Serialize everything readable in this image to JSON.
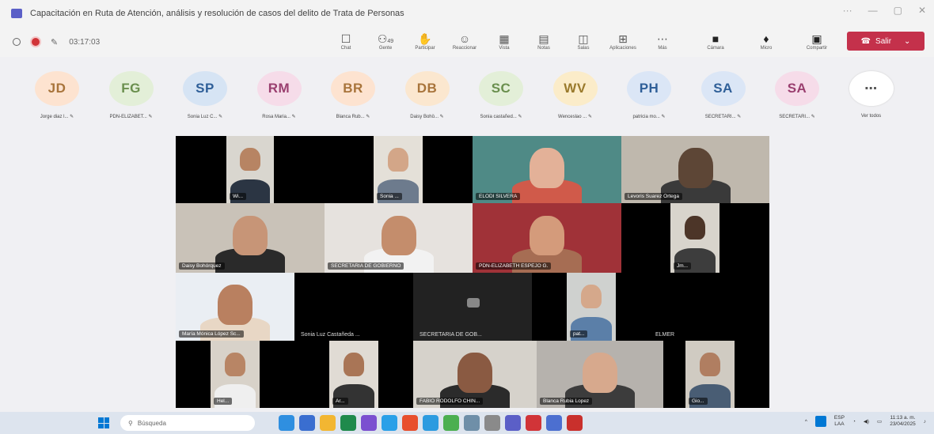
{
  "window": {
    "title": "Capacitación en Ruta de Atención, análisis y resolución de casos del delito de Trata de Personas"
  },
  "toolbar": {
    "timer": "03:17:03",
    "tools": [
      {
        "icon": "chat-icon",
        "glyph": "☐",
        "label": "Chat"
      },
      {
        "icon": "people-icon",
        "glyph": "⚇",
        "label": "Gente",
        "badge": "49"
      },
      {
        "icon": "raise-hand-icon",
        "glyph": "✋",
        "label": "Participar"
      },
      {
        "icon": "react-icon",
        "glyph": "☺",
        "label": "Reaccionar"
      },
      {
        "icon": "view-icon",
        "glyph": "▦",
        "label": "Vista"
      },
      {
        "icon": "notes-icon",
        "glyph": "▤",
        "label": "Notas"
      },
      {
        "icon": "rooms-icon",
        "glyph": "◫",
        "label": "Salas"
      },
      {
        "icon": "apps-icon",
        "glyph": "⊞",
        "label": "Aplicaciones"
      },
      {
        "icon": "more-icon",
        "glyph": "⋯",
        "label": "Más"
      }
    ],
    "media": [
      {
        "icon": "camera-icon",
        "glyph": "■",
        "label": "Cámara"
      },
      {
        "icon": "mic-icon",
        "glyph": "♦",
        "label": "Micro"
      },
      {
        "icon": "share-icon",
        "glyph": "▣",
        "label": "Compartir"
      }
    ],
    "leave_label": "Salir"
  },
  "participants": [
    {
      "initials": "JD",
      "name": "Jorge diaz l...",
      "bg": "#fde3d0",
      "fg": "#a8743b"
    },
    {
      "initials": "FG",
      "name": "PDN-ELIZABET...",
      "bg": "#e3efd8",
      "fg": "#6a8f4e"
    },
    {
      "initials": "SP",
      "name": "Sonia Luz C...",
      "bg": "#d6e4f4",
      "fg": "#2f5f98"
    },
    {
      "initials": "RM",
      "name": "Rosa Maria...",
      "bg": "#f6dce9",
      "fg": "#9a3f6f"
    },
    {
      "initials": "BR",
      "name": "Blanca Rub...",
      "bg": "#fde3d0",
      "fg": "#a8743b"
    },
    {
      "initials": "DB",
      "name": "Daisy Bohö...",
      "bg": "#fbe7cf",
      "fg": "#a8743b"
    },
    {
      "initials": "SC",
      "name": "Sonia castañed...",
      "bg": "#e3efd8",
      "fg": "#6a8f4e"
    },
    {
      "initials": "WV",
      "name": "Wenceslao ...",
      "bg": "#fbecc9",
      "fg": "#9a7a2c"
    },
    {
      "initials": "PH",
      "name": "patricia mo...",
      "bg": "#dbe6f6",
      "fg": "#2f5f98"
    },
    {
      "initials": "SA",
      "name": "SECRETARI...",
      "bg": "#dbe6f6",
      "fg": "#2f5f98"
    },
    {
      "initials": "SA",
      "name": "SECRETARI...",
      "bg": "#f6dce9",
      "fg": "#9a3f6f"
    }
  ],
  "more_participants": {
    "glyph": "⋯",
    "label": "Ver todos"
  },
  "tiles": [
    {
      "name": "Wi...",
      "bg": "#d9d6cf",
      "skin": "#b78463",
      "shirt": "#2b3543"
    },
    {
      "name": "Sonia ...",
      "bg": "#e4e0d8",
      "skin": "#d3a688",
      "shirt": "#6d7b8d"
    },
    {
      "name": "ELODI SILVERA",
      "bg": "#4f8a86",
      "skin": "#e3b198",
      "shirt": "#d05a4a"
    },
    {
      "name": "Levoris Suarez Ortega",
      "bg": "#bfb8ad",
      "skin": "#5d4636",
      "shirt": "#3a3a3a"
    },
    {
      "name": "Daisy Bohórquez",
      "bg": "#c9c2b8",
      "skin": "#c79577",
      "shirt": "#2a2a2a"
    },
    {
      "name": "SECRETARIA DE GOBIERNO",
      "bg": "#e6e2de",
      "skin": "#c48d6c",
      "shirt": "#f2f2f2"
    },
    {
      "name": "PDN-ELIZABETH ESPEJO G.",
      "bg": "#a03238",
      "skin": "#d49b7b",
      "shirt": "#a66d53"
    },
    {
      "name": "Jm...",
      "bg": "#d8d4cc",
      "skin": "#4c3528",
      "shirt": "#3d3d3d"
    },
    {
      "name": "María Mónica López Sc...",
      "bg": "#eaeef3",
      "skin": "#b98060",
      "shirt": "#e8d7c5"
    },
    {
      "name": "Sonia Luz Castañeda ...",
      "bg": "#000000"
    },
    {
      "name": "SECRETARIA DE GOB...",
      "bg": "#222222"
    },
    {
      "name": "pat...",
      "bg": "#cfd1cf",
      "skin": "#d5a88b",
      "shirt": "#5b7fa8"
    },
    {
      "name": "ELMER",
      "bg": "#000000"
    },
    {
      "name": "Hel...",
      "bg": "#d8d2c9",
      "skin": "#b88565",
      "shirt": "#efefef"
    },
    {
      "name": "Ar...",
      "bg": "#e0dbd4",
      "skin": "#a97556",
      "shirt": "#333333"
    },
    {
      "name": "FABIO RODOLFO CHIN...",
      "bg": "#d6d2cb",
      "skin": "#8a5a42",
      "shirt": "#2b2b2b"
    },
    {
      "name": "Blanca Rubia Lopez",
      "bg": "#b6b2ad",
      "skin": "#d7a98d",
      "shirt": "#3c3c3c"
    },
    {
      "name": "Gio...",
      "bg": "#d0cbc2",
      "skin": "#b07e61",
      "shirt": "#495d74"
    }
  ],
  "taskbar": {
    "search_placeholder": "Búsqueda",
    "app_colors": [
      "#2f8fe0",
      "#3a6ed0",
      "#f2b632",
      "#1f8a4c",
      "#7b4fd0",
      "#2aa0e8",
      "#e84f2d",
      "#2c9be0",
      "#4caf50",
      "#6f8fa8",
      "#8a8a8a",
      "#5b5fc7",
      "#d13438",
      "#4c6fd0",
      "#c9302c"
    ],
    "lang_top": "ESP",
    "lang_bottom": "LAA",
    "time": "11:13 a. m.",
    "date": "23/04/2025"
  }
}
